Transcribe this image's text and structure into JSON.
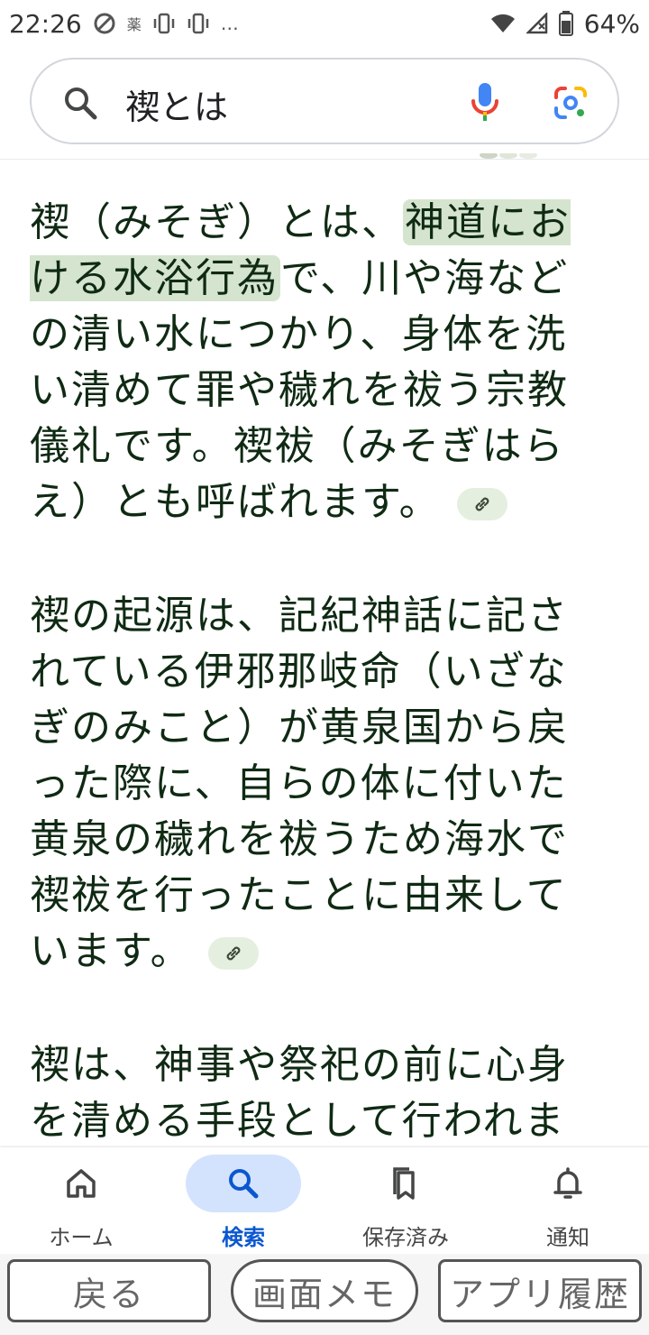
{
  "status_bar": {
    "time": "22:26",
    "left_icons": [
      "data-saver-icon",
      "pharmacy-icon",
      "vibrate-icon",
      "vibrate-icon-2"
    ],
    "more_indicator": "…",
    "yaku": "薬",
    "battery": "64%"
  },
  "search": {
    "query": "禊とは"
  },
  "content": {
    "paragraphs": [
      {
        "before": "禊（みそぎ）とは、",
        "highlight": "神道における水浴行為",
        "after": "で、川や海などの清い水につかり、身体を洗い清めて罪や穢れを祓う宗教儀礼です。禊祓（みそぎはらえ）とも呼ばれます。"
      },
      {
        "text": "禊の起源は、記紀神話に記されている伊邪那岐命（いざなぎのみこと）が黄泉国から戻った際に、自らの体に付いた黄泉の穢れを祓うため海水で禊祓を行ったことに由来しています。"
      },
      {
        "text": "禊は、神事や祭祀の前に心身を清める手段として行われます。また、服喪など異常な忌"
      }
    ]
  },
  "bottom_nav": {
    "items": [
      {
        "label": "ホーム",
        "icon": "home-icon"
      },
      {
        "label": "検索",
        "icon": "search-icon",
        "active": true
      },
      {
        "label": "保存済み",
        "icon": "bookmarks-icon"
      },
      {
        "label": "通知",
        "icon": "bell-icon"
      }
    ]
  },
  "system_buttons": {
    "back": "戻る",
    "memo": "画面メモ",
    "apps": "アプリ履歴"
  },
  "colors": {
    "highlight": "#d5e4ce",
    "text": "#0f2a13",
    "active_nav": "#0b57d0",
    "nav_pill": "#d3e3fd"
  }
}
